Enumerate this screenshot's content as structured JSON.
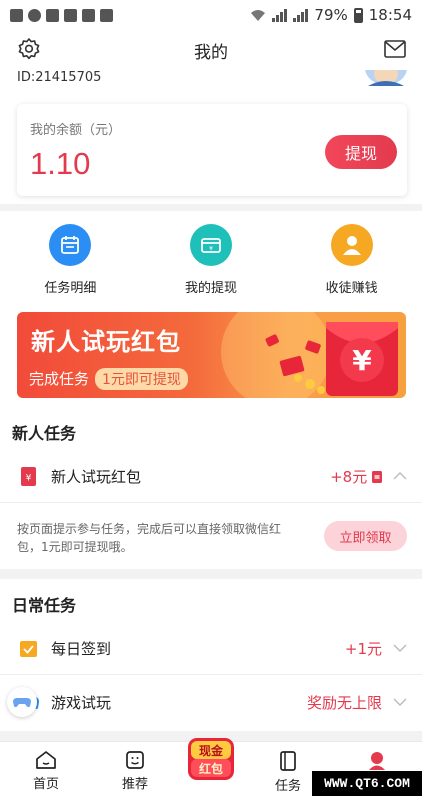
{
  "status_bar": {
    "battery": "79%",
    "time": "18:54"
  },
  "header": {
    "title": "我的",
    "user_id": "ID:21415705"
  },
  "balance": {
    "label": "我的余额（元）",
    "amount": "1.10",
    "withdraw_label": "提现"
  },
  "actions": [
    {
      "label": "任务明细",
      "icon": "calendar-icon",
      "color": "#2b8ef5"
    },
    {
      "label": "我的提现",
      "icon": "wallet-icon",
      "color": "#1fc0b9"
    },
    {
      "label": "收徒赚钱",
      "icon": "user-icon",
      "color": "#f7a823"
    }
  ],
  "banner": {
    "title": "新人试玩红包",
    "subtitle": "完成任务",
    "highlight": "1元即可提现"
  },
  "newbie_section": {
    "title": "新人任务",
    "task": {
      "label": "新人试玩红包",
      "reward": "+8元"
    },
    "description": "按页面提示参与任务，完成后可以直接领取微信红包，1元即可提现哦。",
    "claim_label": "立即领取"
  },
  "daily_section": {
    "title": "日常任务",
    "tasks": [
      {
        "label": "每日签到",
        "reward": "+1元"
      },
      {
        "label": "游戏试玩",
        "reward": "奖励无上限"
      }
    ]
  },
  "tabbar": {
    "home": "首页",
    "recommend": "推荐",
    "center_badge_top": "现金",
    "center_badge_bottom": "红包",
    "tasks": "任务"
  },
  "watermark": "WWW.QT6.COM",
  "colors": {
    "accent": "#e33a4e"
  }
}
